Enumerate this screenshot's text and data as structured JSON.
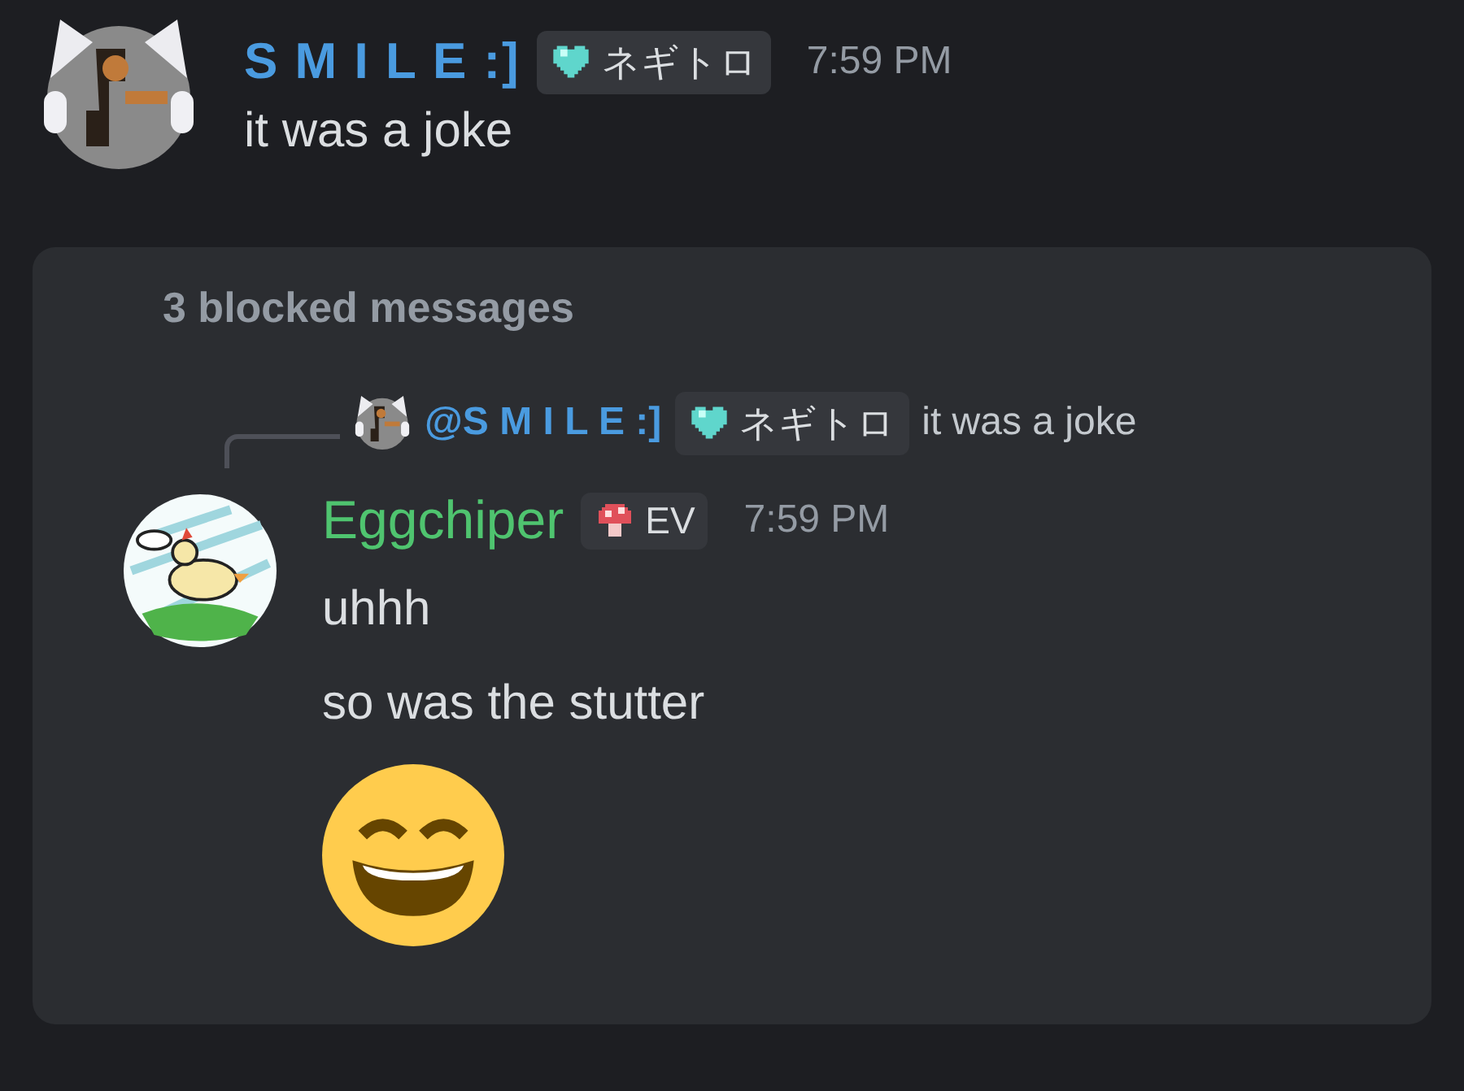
{
  "messages": [
    {
      "author": "S M I L E :]",
      "color": "#4a9be0",
      "tag": {
        "kind": "heart",
        "text": "ネギトロ"
      },
      "time": "7:59 PM",
      "lines": [
        "it was a joke"
      ]
    }
  ],
  "blocked_group": {
    "notice": "3 blocked messages",
    "reply": {
      "author": "@S M I L E :]",
      "color": "#4a9be0",
      "tag": {
        "kind": "heart",
        "text": "ネギトロ"
      },
      "text": "it was a joke"
    },
    "message": {
      "author": "Eggchiper",
      "color": "#4fc46f",
      "tag": {
        "kind": "mushroom",
        "text": "EV"
      },
      "time": "7:59 PM",
      "lines": [
        "uhhh",
        "so was the stutter"
      ],
      "emoji": {
        "kind": "grinning"
      }
    }
  }
}
